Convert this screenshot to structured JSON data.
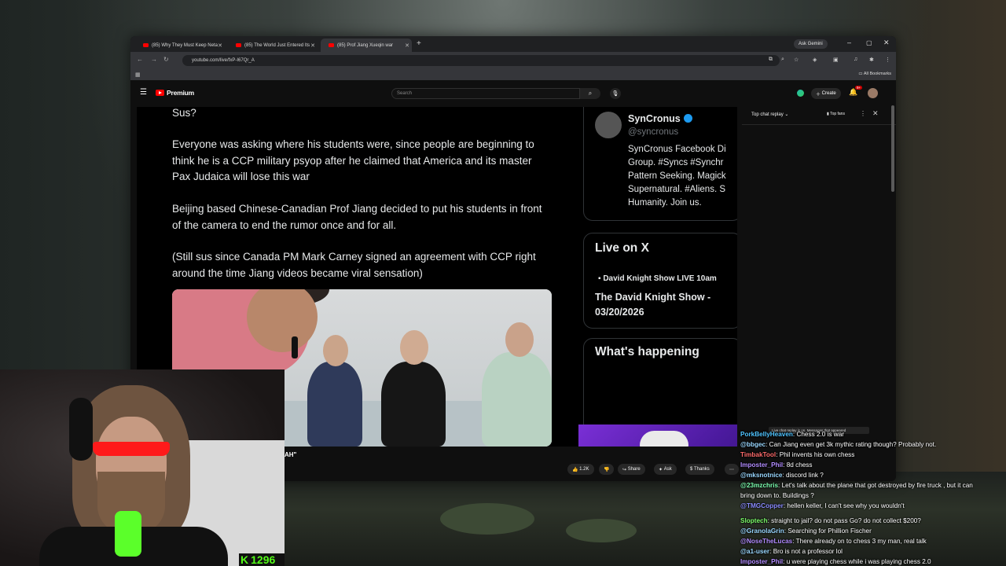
{
  "browser": {
    "tabs": [
      {
        "label": "(85) Why They Must Keep Neta",
        "active": false
      },
      {
        "label": "(85) The World Just Entered Its",
        "active": false
      },
      {
        "label": "(85) Prof Jiang Xueqin war",
        "active": true
      }
    ],
    "ask_gemini": "Ask Gemini",
    "url": "youtube.com/live/fxP-I67Qr_A",
    "all_bookmarks": "All Bookmarks"
  },
  "youtube": {
    "logo_text": "Premium",
    "search_placeholder": "Search",
    "create_label": "Create",
    "notif_count": "9+",
    "video_title_fragment": "AH\"",
    "actions": {
      "likes": "1.2K",
      "share": "Share",
      "ask": "Ask",
      "thanks": "Thanks"
    },
    "chat": {
      "mode": "Top chat replay",
      "fans": "Top fans"
    }
  },
  "tweet": {
    "line0": "Sus?",
    "para1": "Everyone was asking where his students were, since people are beginning to think he is a CCP military psyop after he claimed that America and its master Pax Judaica will lose this war",
    "para2": "Beijing based Chinese-Canadian Prof Jiang decided to put his students in front of the camera to end the rumor once and for all.",
    "para3": "(Still sus since Canada PM Mark Carney signed an agreement with CCP right around the time Jiang videos became viral sensation)"
  },
  "sidebar_profile": {
    "name": "SynCronus",
    "handle": "@syncronus",
    "bio": [
      "SynCronus Facebook Di",
      "Group. #Syncs #Synchr",
      "Pattern Seeking. Magick",
      "Supernatural. #Aliens. S",
      "Humanity. Join us."
    ]
  },
  "live_on_x": {
    "heading": "Live on X",
    "source": "David Knight Show LIVE 10am",
    "title": "The David Knight Show - 03/20/2026"
  },
  "whats_happening": "What's happening",
  "kick_viewers": "1296",
  "system_message": "Live chat replay is on. Messages that appeared",
  "overlay_chat": [
    {
      "user": "PorkBellyHeaven",
      "text": "Chess 2.0 is war",
      "color": "#4fc3ff"
    },
    {
      "user": "@bbgec",
      "text": "Can Jiang even get 3k mythic rating though? Probably not.",
      "color": "#9ad7ff"
    },
    {
      "user": "TimbakTool",
      "text": "Phil invents his own chess",
      "color": "#ff6b6b"
    },
    {
      "user": "Imposter_Phil",
      "text": "8d chess",
      "color": "#b28cff"
    },
    {
      "user": "@mksnotnice",
      "text": "discord link ?",
      "color": "#9ad7ff"
    },
    {
      "user": "@23mzchris",
      "text": "Let's talk about the plane that got destroyed by fire truck , but it can",
      "color": "#7dffb0"
    },
    {
      "user": "",
      "text": "bring down to. Buildings ?",
      "color": "#ffffff"
    },
    {
      "user": "@TMGCopper",
      "text": "hellen keller, I can't see why you wouldn't",
      "color": "#8a8cff"
    },
    {
      "user": "Sloptech",
      "text": "straight to jail? do not pass Go? do not collect $200?",
      "color": "#7dff6b"
    },
    {
      "user": "@GranolaGrin",
      "text": "Searching for Phillion Fischer",
      "color": "#9ad7ff"
    },
    {
      "user": "@NoseTheLucas",
      "text": "There already on to chess 3 my man, real talk",
      "color": "#b28cff"
    },
    {
      "user": "@a1-user",
      "text": "Bro is not a professor lol",
      "color": "#9ad7ff"
    },
    {
      "user": "Imposter_Phil",
      "text": "u were playing chess while i was playing chess 2.0",
      "color": "#b28cff"
    }
  ]
}
